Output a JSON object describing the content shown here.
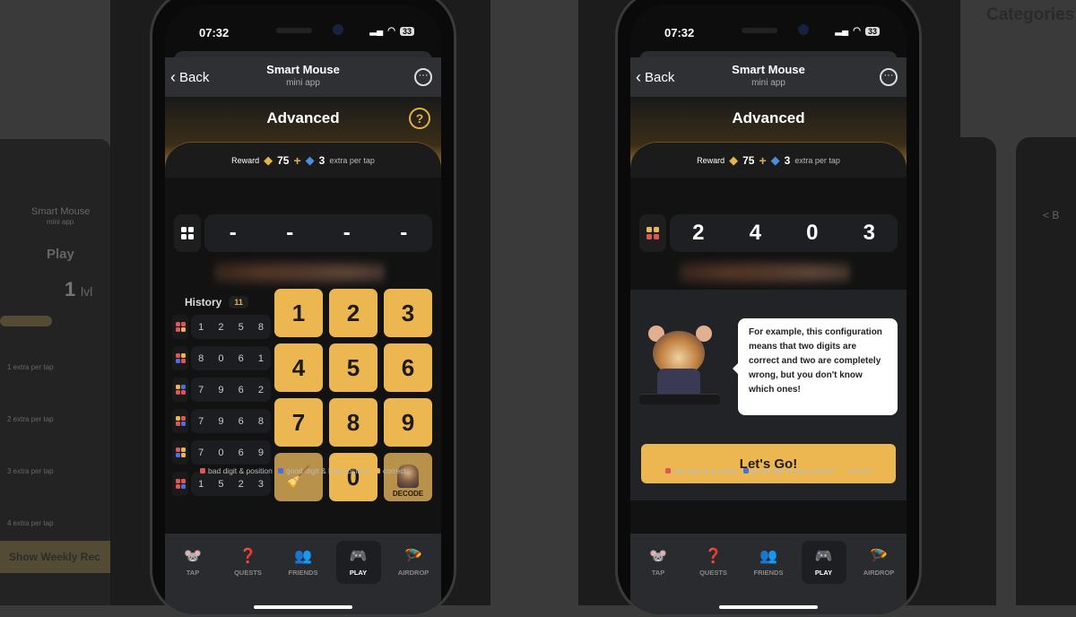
{
  "page": {
    "categories_label": "Categories"
  },
  "colors": {
    "accent": "#ecb750",
    "bad": "#e05555",
    "good": "#4a6fe0",
    "correct": "#ecb750"
  },
  "phones": [
    {
      "status": {
        "time": "07:32",
        "battery": "33"
      },
      "header": {
        "back": "Back",
        "title": "Smart Mouse",
        "subtitle": "mini app"
      },
      "level_title": "Advanced",
      "help_icon": "?",
      "reward": {
        "label": "Reward",
        "gold": "75",
        "plus": "+",
        "blue": "3",
        "extra": "extra per tap"
      },
      "code": [
        "-",
        "-",
        "-",
        "-"
      ],
      "history": {
        "label": "History",
        "count": "11",
        "rows": [
          {
            "digits": [
              "1",
              "2",
              "5",
              "8"
            ],
            "status": [
              "bad",
              "bad",
              "bad",
              "correct"
            ]
          },
          {
            "digits": [
              "8",
              "0",
              "6",
              "1"
            ],
            "status": [
              "bad",
              "correct",
              "good",
              "bad"
            ]
          },
          {
            "digits": [
              "7",
              "9",
              "6",
              "2"
            ],
            "status": [
              "correct",
              "good",
              "bad",
              "bad"
            ]
          },
          {
            "digits": [
              "7",
              "9",
              "6",
              "8"
            ],
            "status": [
              "correct",
              "bad",
              "bad",
              "good"
            ]
          },
          {
            "digits": [
              "7",
              "0",
              "6",
              "9"
            ],
            "status": [
              "bad",
              "correct",
              "good",
              "correct"
            ]
          },
          {
            "digits": [
              "1",
              "5",
              "2",
              "3"
            ],
            "status": [
              "bad",
              "bad",
              "bad",
              "good"
            ]
          }
        ]
      },
      "keypad": [
        "1",
        "2",
        "3",
        "4",
        "5",
        "6",
        "7",
        "8",
        "9",
        "clear",
        "0",
        "DECODE"
      ],
      "legend": [
        "bad digit & position",
        "good digit & bad position",
        "correct"
      ],
      "nav": [
        {
          "label": "TAP",
          "icon": "mouse-icon"
        },
        {
          "label": "QUESTS",
          "icon": "quest-icon"
        },
        {
          "label": "FRIENDS",
          "icon": "friends-icon"
        },
        {
          "label": "PLAY",
          "icon": "gamepad-icon",
          "active": true
        },
        {
          "label": "AIRDROP",
          "icon": "parachute-icon"
        }
      ]
    },
    {
      "status": {
        "time": "07:32",
        "battery": "33"
      },
      "header": {
        "back": "Back",
        "title": "Smart Mouse",
        "subtitle": "mini app"
      },
      "level_title": "Advanced",
      "reward": {
        "label": "Reward",
        "gold": "75",
        "plus": "+",
        "blue": "3",
        "extra": "extra per tap"
      },
      "code": [
        "2",
        "4",
        "0",
        "3"
      ],
      "code_status": [
        "correct",
        "correct",
        "bad",
        "bad"
      ],
      "tutorial": {
        "text": "For example, this configuration means that two digits are correct and two are completely wrong, but you don't know which ones!",
        "button": "Let's Go!"
      },
      "legend": [
        "bad digit & position",
        "good digit & bad position",
        "correct"
      ],
      "nav": [
        {
          "label": "TAP"
        },
        {
          "label": "QUESTS"
        },
        {
          "label": "FRIENDS"
        },
        {
          "label": "PLAY",
          "active": true
        },
        {
          "label": "AIRDROP"
        }
      ]
    }
  ],
  "ghost_left": {
    "title": "Smart Mouse",
    "subtitle": "mini app",
    "play": "Play",
    "level": "1",
    "level_unit": "lvl",
    "rows": [
      "1 extra per tap",
      "2 extra per tap",
      "3 extra per tap",
      "4 extra per tap"
    ],
    "weekly_button": "Show Weekly Rec"
  }
}
